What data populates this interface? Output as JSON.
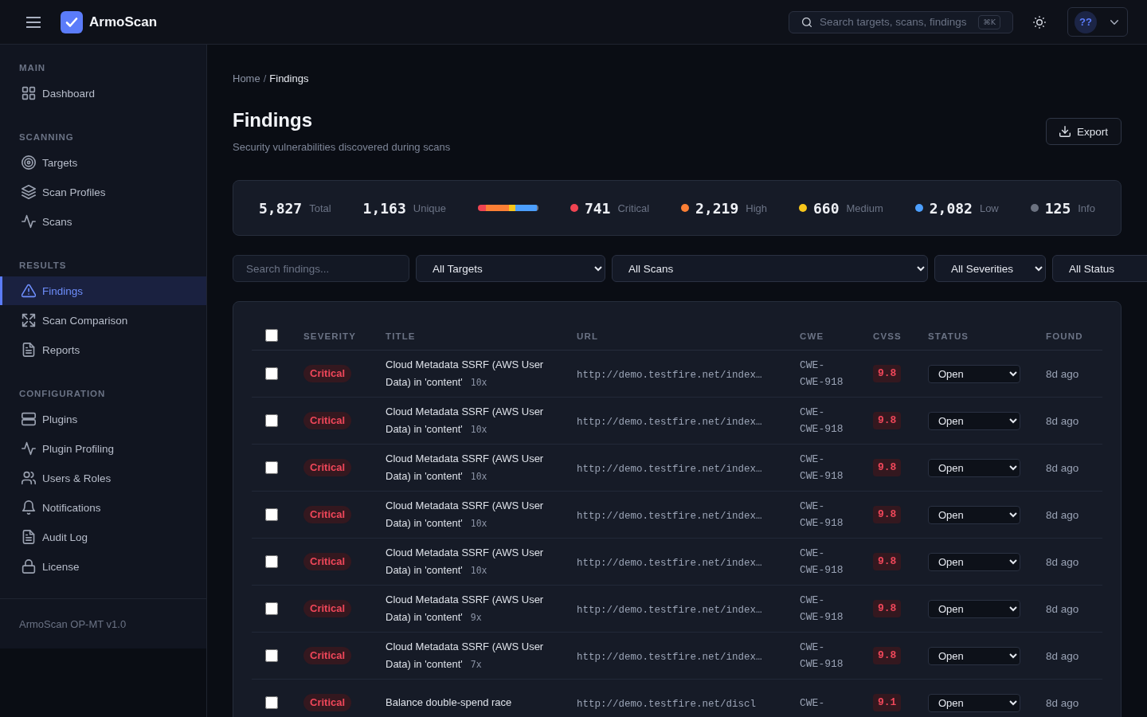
{
  "topbar": {
    "brand": "ArmoScan",
    "search": {
      "placeholder": "Search targets, scans, findings",
      "shortcut": "⌘K"
    },
    "user": {
      "initials": "??"
    }
  },
  "sidebar": {
    "sections": [
      {
        "label": "MAIN",
        "items": [
          {
            "label": "Dashboard",
            "selected": false
          }
        ]
      },
      {
        "label": "SCANNING",
        "items": [
          {
            "label": "Targets",
            "selected": false
          },
          {
            "label": "Scan Profiles",
            "selected": false
          },
          {
            "label": "Scans",
            "selected": false
          }
        ]
      },
      {
        "label": "RESULTS",
        "items": [
          {
            "label": "Findings",
            "selected": true
          },
          {
            "label": "Scan Comparison",
            "selected": false
          },
          {
            "label": "Reports",
            "selected": false
          }
        ]
      },
      {
        "label": "CONFIGURATION",
        "items": [
          {
            "label": "Plugins",
            "selected": false
          },
          {
            "label": "Plugin Profiling",
            "selected": false
          },
          {
            "label": "Users & Roles",
            "selected": false
          },
          {
            "label": "Notifications",
            "selected": false
          },
          {
            "label": "Audit Log",
            "selected": false
          },
          {
            "label": "License",
            "selected": false
          }
        ]
      }
    ],
    "footer": "ArmoScan OP-MT v1.0"
  },
  "breadcrumb": {
    "items": [
      {
        "label": "Home",
        "current": false
      },
      {
        "label": "Findings",
        "current": true
      }
    ],
    "separator": "/"
  },
  "header": {
    "title": "Findings",
    "subtitle": "Security vulnerabilities discovered during scans",
    "export_button": "Export"
  },
  "stats": {
    "total": {
      "value": "5,827",
      "label": "Total"
    },
    "unique": {
      "value": "1,163",
      "label": "Unique"
    },
    "severities": [
      {
        "value": "741",
        "label": "Critical",
        "color": "#ef4452"
      },
      {
        "value": "2,219",
        "label": "High",
        "color": "#fb7f35"
      },
      {
        "value": "660",
        "label": "Medium",
        "color": "#f7c61b"
      },
      {
        "value": "2,082",
        "label": "Low",
        "color": "#4c9ffe"
      },
      {
        "value": "125",
        "label": "Info",
        "color": "#6b7280"
      }
    ]
  },
  "filters": {
    "search": {
      "placeholder": "Search findings..."
    },
    "selects": [
      "All Targets",
      "All Scans",
      "All Severities",
      "All Status"
    ]
  },
  "table": {
    "select_all": {
      "checked": false
    },
    "columns": [
      "SEVERITY",
      "TITLE",
      "URL",
      "CWE",
      "CVSS",
      "STATUS",
      "FOUND"
    ],
    "rows": [
      {
        "checked": false,
        "severity": {
          "label": "Critical",
          "kind": "critical"
        },
        "title": "Cloud Metadata SSRF (AWS User Data) in 'content'",
        "count": "10x",
        "url": "http://demo.testfire.net/index…",
        "cwe": "CWE-CWE-918",
        "cvss": "9.8",
        "status": "Open",
        "found": "8d ago"
      },
      {
        "checked": false,
        "severity": {
          "label": "Critical",
          "kind": "critical"
        },
        "title": "Cloud Metadata SSRF (AWS User Data) in 'content'",
        "count": "10x",
        "url": "http://demo.testfire.net/index…",
        "cwe": "CWE-CWE-918",
        "cvss": "9.8",
        "status": "Open",
        "found": "8d ago"
      },
      {
        "checked": false,
        "severity": {
          "label": "Critical",
          "kind": "critical"
        },
        "title": "Cloud Metadata SSRF (AWS User Data) in 'content'",
        "count": "10x",
        "url": "http://demo.testfire.net/index…",
        "cwe": "CWE-CWE-918",
        "cvss": "9.8",
        "status": "Open",
        "found": "8d ago"
      },
      {
        "checked": false,
        "severity": {
          "label": "Critical",
          "kind": "critical"
        },
        "title": "Cloud Metadata SSRF (AWS User Data) in 'content'",
        "count": "10x",
        "url": "http://demo.testfire.net/index…",
        "cwe": "CWE-CWE-918",
        "cvss": "9.8",
        "status": "Open",
        "found": "8d ago"
      },
      {
        "checked": false,
        "severity": {
          "label": "Critical",
          "kind": "critical"
        },
        "title": "Cloud Metadata SSRF (AWS User Data) in 'content'",
        "count": "10x",
        "url": "http://demo.testfire.net/index…",
        "cwe": "CWE-CWE-918",
        "cvss": "9.8",
        "status": "Open",
        "found": "8d ago"
      },
      {
        "checked": false,
        "severity": {
          "label": "Critical",
          "kind": "critical"
        },
        "title": "Cloud Metadata SSRF (AWS User Data) in 'content'",
        "count": "9x",
        "url": "http://demo.testfire.net/index…",
        "cwe": "CWE-CWE-918",
        "cvss": "9.8",
        "status": "Open",
        "found": "8d ago"
      },
      {
        "checked": false,
        "severity": {
          "label": "Critical",
          "kind": "critical"
        },
        "title": "Cloud Metadata SSRF (AWS User Data) in 'content'",
        "count": "7x",
        "url": "http://demo.testfire.net/index…",
        "cwe": "CWE-CWE-918",
        "cvss": "9.8",
        "status": "Open",
        "found": "8d ago"
      },
      {
        "checked": false,
        "severity": {
          "label": "Critical",
          "kind": "critical"
        },
        "title": "Balance double-spend race",
        "url": "http://demo.testfire.net/discl",
        "cwe": "CWE-",
        "cvss": "9.1",
        "status": "Open",
        "found": "8d ago"
      }
    ]
  }
}
